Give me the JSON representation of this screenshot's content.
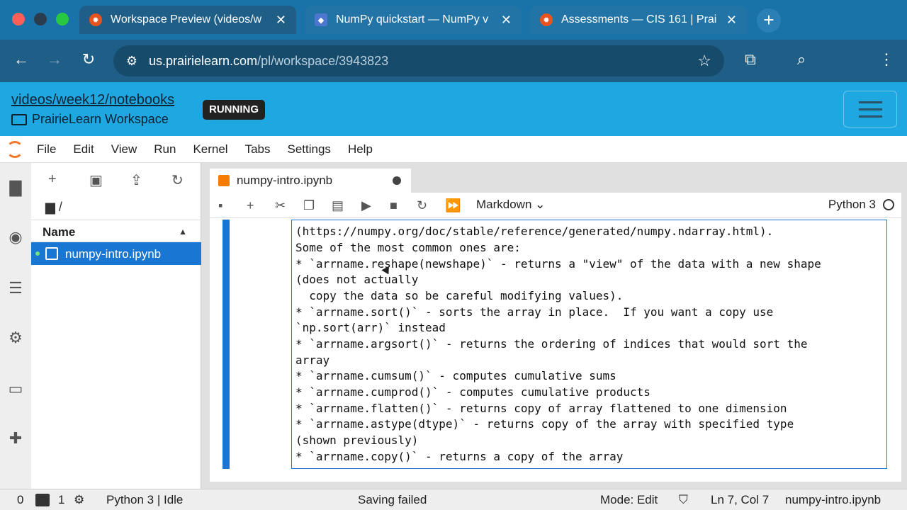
{
  "browser": {
    "tabs": [
      {
        "title": "Workspace Preview (videos/w",
        "favicon": "prairielearn-favicon",
        "active": true
      },
      {
        "title": "NumPy quickstart — NumPy v",
        "favicon": "numpy-favicon",
        "active": false
      },
      {
        "title": "Assessments — CIS 161 | Prai",
        "favicon": "prairielearn-favicon",
        "active": false
      }
    ],
    "new_tab": "+",
    "url_host": "us.prairielearn.com",
    "url_path": "/pl/workspace/3943823"
  },
  "pl_header": {
    "breadcrumb": "videos/week12/notebooks",
    "subtitle": "PrairieLearn Workspace",
    "status_badge": "RUNNING"
  },
  "menu": [
    "File",
    "Edit",
    "View",
    "Run",
    "Kernel",
    "Tabs",
    "Settings",
    "Help"
  ],
  "file_browser": {
    "path": "/",
    "column_header": "Name",
    "files": [
      {
        "name": "numpy-intro.ipynb",
        "running": true,
        "selected": true
      }
    ]
  },
  "notebook": {
    "tab_title": "numpy-intro.ipynb",
    "cell_type": "Markdown",
    "kernel": "Python 3",
    "lines": [
      "(https://numpy.org/doc/stable/reference/generated/numpy.ndarray.html).",
      "Some of the most common ones are:",
      "* `arrname.reshape(newshape)` - returns a \"view\" of the data with a new shape",
      "(does not actually",
      "  copy the data so be careful modifying values).",
      "* `arrname.sort()` - sorts the array in place.  If you want a copy use",
      "`np.sort(arr)` instead",
      "* `arrname.argsort()` - returns the ordering of indices that would sort the",
      "array",
      "* `arrname.cumsum()` - computes cumulative sums",
      "* `arrname.cumprod()` - computes cumulative products",
      "* `arrname.flatten()` - returns copy of array flattened to one dimension",
      "* `arrname.astype(dtype)` - returns copy of the array with specified type",
      "(shown previously)",
      "* `arrname.copy()` - returns a copy of the array"
    ]
  },
  "status_bar": {
    "terminals": "0",
    "kernels": "1",
    "kernel_status": "Python 3 | Idle",
    "message": "Saving failed",
    "mode": "Mode: Edit",
    "position": "Ln 7, Col 7",
    "file": "numpy-intro.ipynb"
  },
  "colors": {
    "accent": "#1976d2",
    "pl_header": "#1ea7e0",
    "browser": "#1f5f87"
  }
}
